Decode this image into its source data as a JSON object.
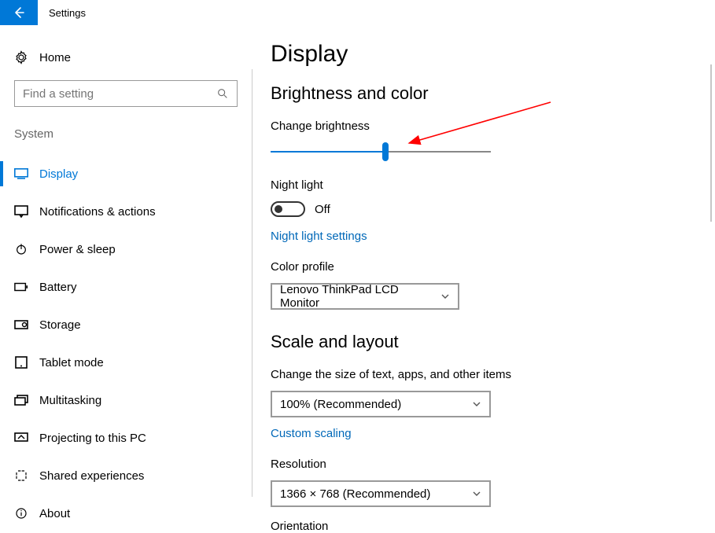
{
  "app_title": "Settings",
  "sidebar": {
    "home_label": "Home",
    "search_placeholder": "Find a setting",
    "group_header": "System",
    "items": [
      {
        "label": "Display",
        "icon": "display-icon",
        "active": true
      },
      {
        "label": "Notifications & actions",
        "icon": "notifications-icon",
        "active": false
      },
      {
        "label": "Power & sleep",
        "icon": "power-icon",
        "active": false
      },
      {
        "label": "Battery",
        "icon": "battery-icon",
        "active": false
      },
      {
        "label": "Storage",
        "icon": "storage-icon",
        "active": false
      },
      {
        "label": "Tablet mode",
        "icon": "tablet-icon",
        "active": false
      },
      {
        "label": "Multitasking",
        "icon": "multitasking-icon",
        "active": false
      },
      {
        "label": "Projecting to this PC",
        "icon": "projecting-icon",
        "active": false
      },
      {
        "label": "Shared experiences",
        "icon": "shared-icon",
        "active": false
      },
      {
        "label": "About",
        "icon": "about-icon",
        "active": false
      }
    ]
  },
  "page": {
    "title": "Display",
    "sections": {
      "brightness": {
        "heading": "Brightness and color",
        "change_brightness_label": "Change brightness",
        "brightness_value_pct": 52,
        "night_light_label": "Night light",
        "night_light_state": "Off",
        "night_light_settings_link": "Night light settings",
        "color_profile_label": "Color profile",
        "color_profile_value": "Lenovo ThinkPad LCD Monitor"
      },
      "scale": {
        "heading": "Scale and layout",
        "size_label": "Change the size of text, apps, and other items",
        "size_value": "100% (Recommended)",
        "custom_scaling_link": "Custom scaling",
        "resolution_label": "Resolution",
        "resolution_value": "1366 × 768 (Recommended)",
        "orientation_label": "Orientation"
      }
    }
  },
  "colors": {
    "accent": "#0078d7",
    "link": "#0068b8",
    "annotation_arrow": "#ff0000"
  }
}
